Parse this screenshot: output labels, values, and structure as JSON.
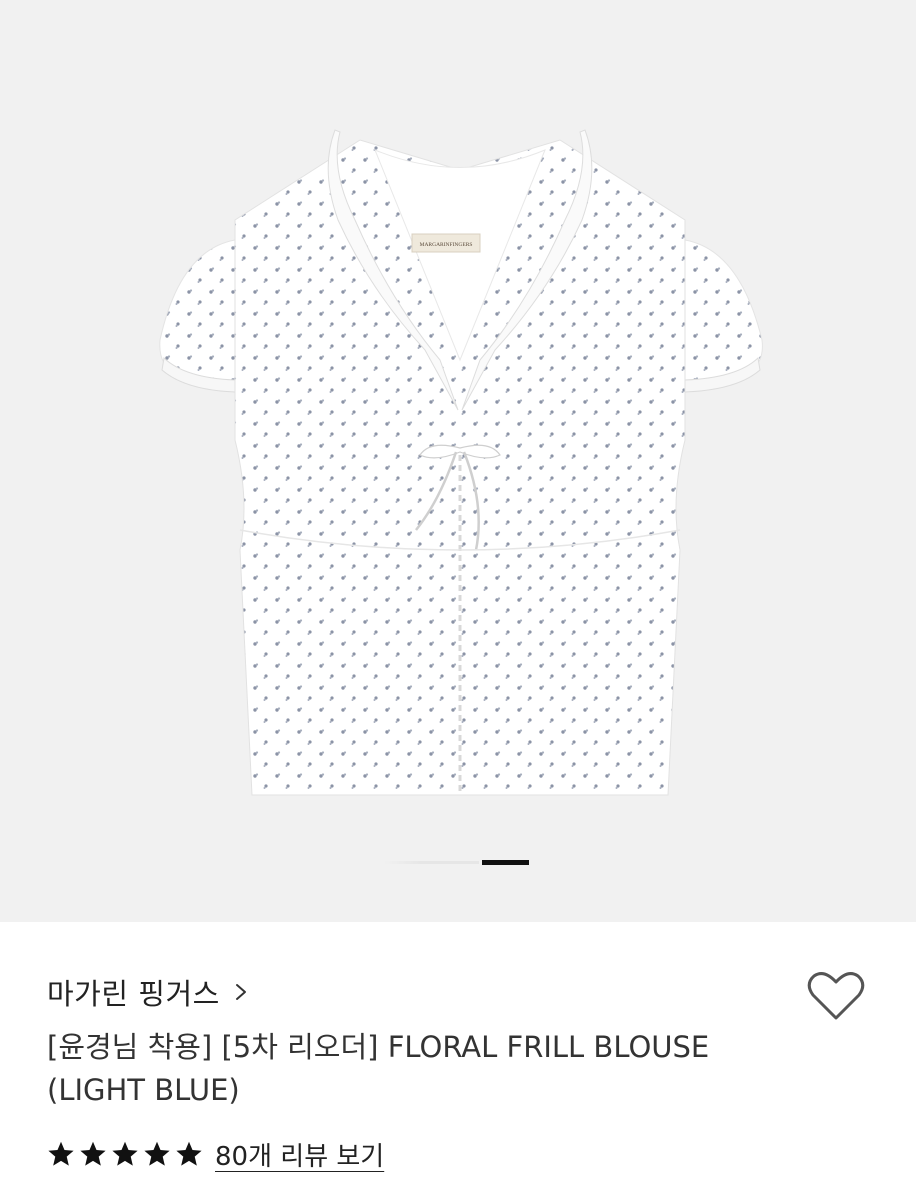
{
  "gallery": {
    "label_text": "MARGARINFINGERS",
    "slide_index": 2,
    "slide_count": 2
  },
  "product": {
    "brand": "마가린 핑거스",
    "title": "[윤경님 착용] [5차 리오더] FLORAL FRILL BLOUSE (LIGHT BLUE)",
    "rating": 5,
    "review_link": "80개 리뷰 보기"
  },
  "icons": {
    "brand_chevron": "chevron-right-icon",
    "wishlist": "heart-outline-icon",
    "star": "star-filled-icon"
  },
  "colors": {
    "gallery_background": "#f1f1f1",
    "text_primary": "#222222",
    "indicator_active": "#111111",
    "print_dots": "#8b93a6"
  }
}
